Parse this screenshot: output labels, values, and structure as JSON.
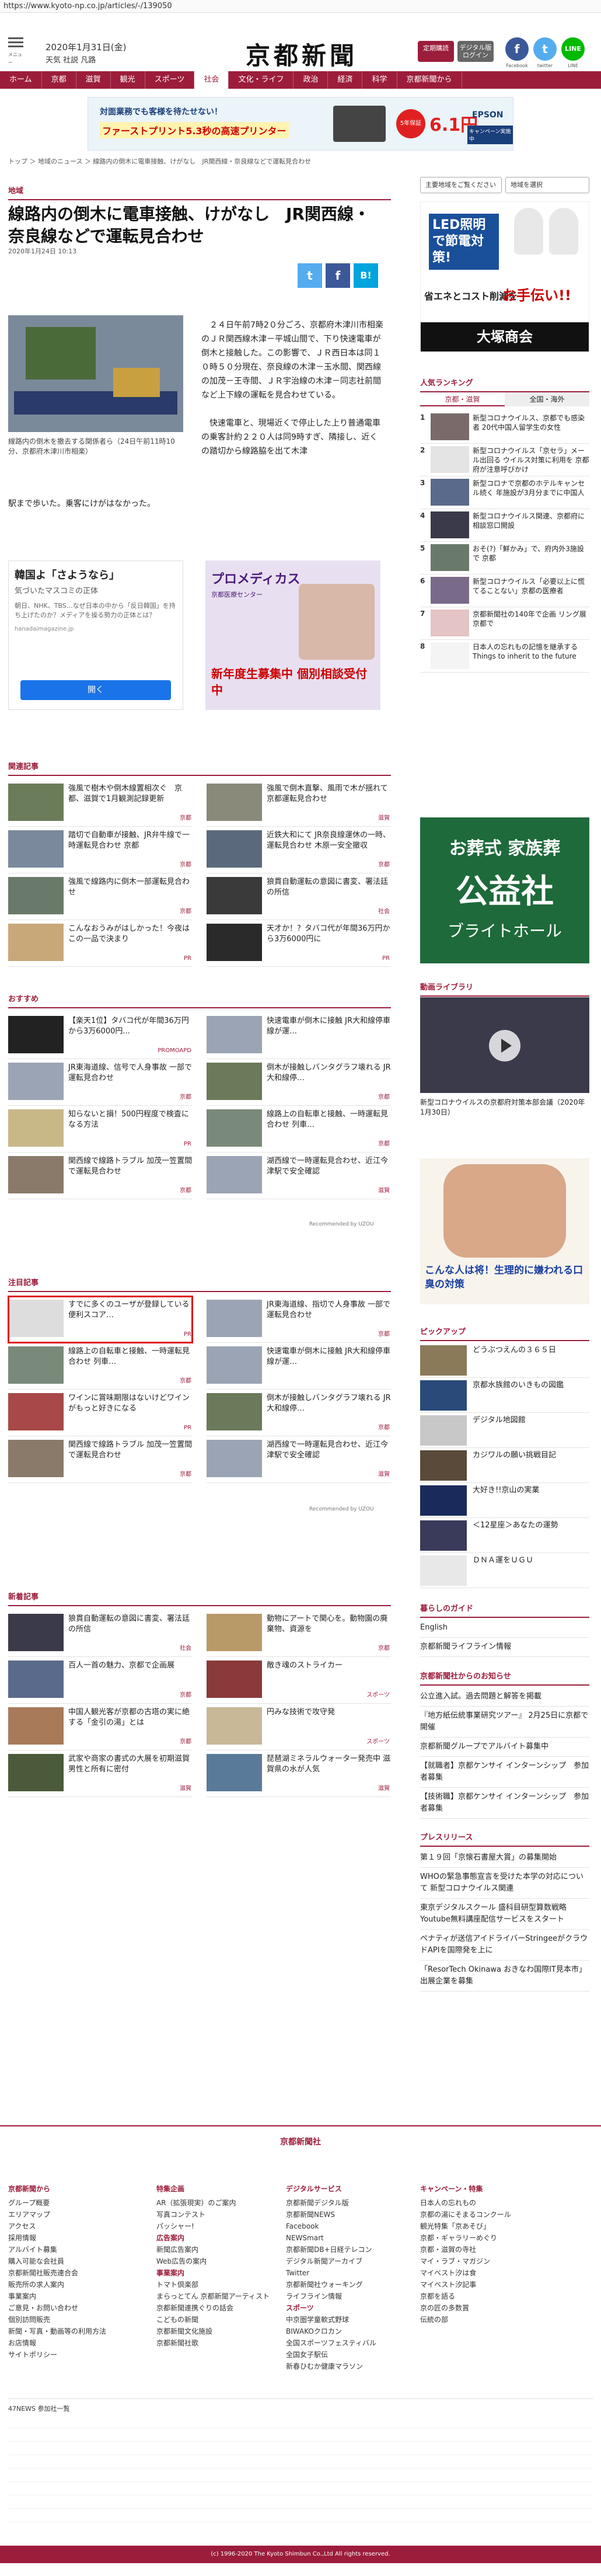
{
  "browser": {
    "url": "https://www.kyoto-np.co.jp/articles/-/139050"
  },
  "header": {
    "menu_label": "メニュー",
    "date": "2020年1月31日(金)",
    "weather": "天気 社説 凡路",
    "logo": "京都新聞",
    "btn_member": "定期購読",
    "btn_digital": "デジタル版ログイン",
    "sns": [
      {
        "label": "Facebook"
      },
      {
        "label": "twitter"
      },
      {
        "label": "LINE"
      }
    ]
  },
  "nav": [
    "ホーム",
    "京都",
    "滋賀",
    "観光",
    "スポーツ",
    "社会",
    "文化・ライフ",
    "政治",
    "経済",
    "科学",
    "京都新聞から"
  ],
  "ad_banner": {
    "title": "対面業務でも客様を待たせない！",
    "sub": "ファーストプリント5.3秒の高速プリンター",
    "badge": "5年保証",
    "price": "6.1円",
    "brand": "EPSON",
    "brand_sub": "キャンペーン実施中"
  },
  "breadcrumb": "トップ ＞ 地域のニュース ＞ 線路内の倒木に電車接触、けがなし　JR関西線・奈良線などで運転見合わせ",
  "selectors": {
    "left": "主要地域をご覧ください",
    "right": "地域を選択",
    "section": "地域"
  },
  "article": {
    "title": "線路内の倒木に電車接触、けがなし　JR関西線・奈良線などで運転見合わせ",
    "date": "2020年1月24日 10:13",
    "caption": "線路内の倒木を撤去する関係者ら（24日午前11時10分、京都府木津川市相楽）",
    "body": "　２４日午前7時2０分ごろ、京都府木津川市相楽のＪＲ関西線木津－平城山間で、下り快速電車が倒木と接触した。この影響で、ＪＲ西日本は同１０時５０分現在、奈良線の木津－玉水間、関西線の加茂－王寺間、ＪＲ宇治線の木津－同志社前間など上下線の運転を見合わせている。\n\n　快速電車と、現場近くで停止した上り普通電車の乗客計約２２０人は同9時すぎ、隣接し、近くの踏切から線路脇を出て木津",
    "tail": "駅まで歩いた。乗客にけがはなかった。"
  },
  "ad_korea": {
    "title": "韓国よ「さようなら」",
    "sub": "気づいたマスコミの正体",
    "body": "朝日、NHK、TBS…なぜ日本の中から「反日韓国」を持ち上げたのか？メディアを操る勢力の正体とは？",
    "source": "hanadaimagazine.jp",
    "cta": "開く"
  },
  "ad_school": {
    "title": "プロメディカス",
    "sub": "京都医療センター",
    "text": "新年度生募集中 個別相談受付中"
  },
  "related": {
    "title": "関連記事",
    "items": [
      {
        "text": "強風で樹木や倒木線置相次ぐ　京都、滋賀で1月観測記録更新",
        "tag": "京都"
      },
      {
        "text": "強風で倒木直撃、風雨で木が揺れて 京都運転見合わせ",
        "tag": "滋賀"
      },
      {
        "text": "踏切で自動車が接触、JR弁牛線で一時運転見合わせ 京都",
        "tag": "京都"
      },
      {
        "text": "近鉄大和にて JR奈良線運休の一時、運転見合わせ 木原一安全撤収",
        "tag": "京都"
      },
      {
        "text": "強風で線路内に倒木一部運転見合わせ",
        "tag": "京都"
      },
      {
        "text": "狼貫自動運転の意図に書変、署法廷の所信",
        "tag": "社会"
      },
      {
        "text": "こんなおうみがはしかった！今夜はこの一品で決まり",
        "tag": "PR"
      },
      {
        "text": "天才か！？タバコ代が年間36万円から3万6000円に",
        "tag": "PR"
      }
    ]
  },
  "recommend": {
    "title": "おすすめ",
    "items": [
      {
        "text": "【楽天1位】タバコ代が年間36万円から3万6000円...",
        "tag": "PROMOAPD"
      },
      {
        "text": "快速電車が倒木に接触 JR大和線停車線が運…",
        "tag": ""
      },
      {
        "text": "JR東海道線、信号で人身事故 一部で運転見合わせ",
        "tag": "京都"
      },
      {
        "text": "倒木が接触しバンタグラフ壊れる JR大和線停…",
        "tag": "京都"
      },
      {
        "text": "知らないと損！500円程度で検査になる方法",
        "tag": "PR"
      },
      {
        "text": "線路上の自転車と接触、一時運転見合わせ 列車…",
        "tag": "京都"
      },
      {
        "text": "関西線で線路トラブル 加茂一笠置間で運転見合わせ",
        "tag": "京都"
      },
      {
        "text": "湖西線で一時運転見合わせ、近江今津駅で安全確認",
        "tag": "滋賀"
      }
    ],
    "credit": "Recommended by UZOU"
  },
  "notable": {
    "title": "注目記事",
    "items": [
      {
        "text": "すでに多くのユーザが登録している便利スコア…",
        "tag": "PR"
      },
      {
        "text": "JR東海道線、指切で人身事故 一部で運転見合わせ",
        "tag": "京都"
      },
      {
        "text": "線路上の自転車と接触、一時運転見合わせ 列車…",
        "tag": "京都"
      },
      {
        "text": "快速電車が倒木に接触 JR大和線停車線が運…",
        "tag": ""
      },
      {
        "text": "ワインに賞味期限はないけどワインがもっと好きになる",
        "tag": "PR"
      },
      {
        "text": "倒木が接触しバンタグラフ壊れる JR大和線停…",
        "tag": "京都"
      },
      {
        "text": "関西線で線路トラブル 加茂一笠置間で運転見合わせ",
        "tag": "京都"
      },
      {
        "text": "湖西線で一時運転見合わせ、近江今津駅で安全確認",
        "tag": "滋賀"
      }
    ],
    "credit": "Recommended by UZOU"
  },
  "new_articles": {
    "title": "新着記事",
    "items": [
      {
        "text": "狼貫自動運転の意図に書変、署法廷の所信",
        "tag": "社会"
      },
      {
        "text": "動物にアートで関心を。動物園の廃棄物、資源を",
        "tag": "京都"
      },
      {
        "text": "百人一首の魅力、京都で企画展",
        "tag": "京都"
      },
      {
        "text": "敵き魂のストライカー",
        "tag": "スポーツ"
      },
      {
        "text": "中国人観光客が京都の古塔の実に絶する「金引の湯」とは",
        "tag": "京都"
      },
      {
        "text": "円みな技術で攻守発",
        "tag": "スポーツ"
      },
      {
        "text": "武家や商家の書式の大展を初期滋賀 男性と所有に密付",
        "tag": "滋賀"
      },
      {
        "text": "琵琶湖ミネラルウォーター発売中 滋賀県の水が人気",
        "tag": "滋賀"
      }
    ]
  },
  "side": {
    "ad_led": {
      "title": "LED照明で節電対策!",
      "sub": "省エネとコスト削減を",
      "accent": "お手伝い!!",
      "brand": "大塚商会"
    },
    "ranking": {
      "title": "人気ランキング",
      "tabs": [
        "京都・滋賀",
        "全国・海外"
      ],
      "items": [
        {
          "n": "1",
          "text": "新型コロナウイルス、京都でも感染者 20代中国人留学生の女性"
        },
        {
          "n": "2",
          "text": "新型コロナウイルス「京セラ」メール出回る ウイルス対策に利用を 京都府が注意呼びかけ"
        },
        {
          "n": "3",
          "text": "新型コロナで京都のホテルキャンセル続く 年施設が3月分までに中国人"
        },
        {
          "n": "4",
          "text": "新型コロナウイルス関連、京都府に相談窓口開設"
        },
        {
          "n": "5",
          "text": "おそ(?)「鮮かみ」で、府内外3施設で 京都"
        },
        {
          "n": "6",
          "text": "新型コロナウイルス「必要以上に慌てることない」京都の医療者"
        },
        {
          "n": "7",
          "text": "京都新聞社の140年で企画 リング展 京都で"
        },
        {
          "n": "8",
          "text": "日本人の忘れもの記憶を継承する Things to inherit to the future"
        }
      ]
    },
    "ad_funeral": {
      "title": "お葬式 家族葬",
      "name": "公益社",
      "sub": "ブライトホール"
    },
    "video": {
      "title": "動画ライブラリ",
      "caption": "新型コロナウイルスの京都府対策本部会議（2020年1月30日）"
    },
    "ad_mouth": {
      "title": "こんな人は将！生理的に嫌われる口臭の対策"
    },
    "pickup": {
      "title": "ピックアップ",
      "items": [
        "どうぶつえんの３６５日",
        "京都水族館のいきもの図鑑",
        "デジタル地図館",
        "カジワルの願い挑戦目記",
        "大好き!!京山の実業",
        "＜12星座＞あなたの運勢",
        "ＤＮＡ運をＵＧＵ"
      ]
    },
    "living": {
      "title": "暮らしのガイド",
      "items": [
        "English",
        "京都新聞ライフライン情報"
      ]
    },
    "notice": {
      "title": "京都新聞社からのお知らせ",
      "items": [
        "公立進入試。過去問題と解答を掲載",
        "『地方紙伝統事業研究ツアー』 2月25日に京都で開催",
        "京都新聞グループでアルバイト募集中",
        "【就職者】京都ケンサイ インターンシップ　参加者募集",
        "【技術職】京都ケンサイ インターンシップ　参加者募集"
      ]
    },
    "press": {
      "title": "プレスリリース",
      "items": [
        "第１９回「京懐石書屋大賞」の募集開始",
        "WHOの緊急事態宣言を受けた本学の対応について 新型コロナウイルス関連",
        "東京デジタルスクール 盛科目研型算数戦略Youtube無料講座配信サービスをスタート",
        "ペナティが送信アイドライバーStringeeがクラウドAPIを国際発を上に",
        "「ResorTech Okinawa おきなわ国際IT見本市」出展企業を募集"
      ]
    }
  },
  "footer": {
    "brand": "京都新聞社",
    "cols": [
      {
        "title": "京都新聞から",
        "items": [
          "グループ概要",
          "エリアマップ",
          "アクセス",
          "採用情報",
          "アルバイト募集",
          "購入可能な会社員",
          "京都新聞社販売連合会",
          "販売所の求人案内",
          "事業案内",
          "ご意見・お問い合わせ",
          "個別訪問販売",
          "新聞・写真・動画等の利用方法",
          "お店情報",
          "サイトポリシー"
        ]
      },
      {
        "title": "特集企画",
        "items": [
          "AR（拡張現実）のご案内",
          "写真コンテスト",
          "パッシャー!",
          "広告案内",
          "新聞広告案内",
          "Web広告の案内",
          "事業案内",
          "トマト倶楽部",
          "まらっとてん 京都新聞アーティスト",
          "京都新聞連携ぐりの話会",
          "こどもの新聞",
          "京都新聞文化施設",
          "京都新聞社歌"
        ]
      },
      {
        "title": "デジタルサービス",
        "items": [
          "京都新聞デジタル版",
          "京都新聞NEWS",
          "Facebook",
          "NEWSmart",
          "京都新聞DB+日経テレコン",
          "デジタル新聞アーカイブ",
          "Twitter",
          "京都新聞社ウォーキング",
          "ライフライン情報",
          "スポーツ",
          "中京圏学童軟式野球",
          "BIWAKOクロカン",
          "全国スポーツフェスティバル",
          "全国女子駅伝",
          "新春ひむか健康マラソン"
        ]
      },
      {
        "title": "キャンペーン・特集",
        "items": [
          "日本人の忘れもの",
          "京都の湯にそまるコンクール",
          "観光特集「京あそび」",
          "京都・ギャラリーめぐり",
          "京都・滋賀の寺社",
          "マイ・ラブ・マガジン",
          "マイベスト汐は食",
          "マイベスト汐記事",
          "京都を語る",
          "京の匠の多数賞",
          "伝統の部"
        ]
      }
    ],
    "foot_links": "47NEWS 参加社一覧",
    "copyright": "(c) 1996-2020 The Kyoto Shimbun Co.,Ltd All rights reserved."
  },
  "colors": {
    "brand": "#9c1d3b",
    "nav_bg": "#9c1d3b",
    "twitter": "#55acee",
    "facebook": "#3b5998",
    "hatena": "#00a4de"
  }
}
